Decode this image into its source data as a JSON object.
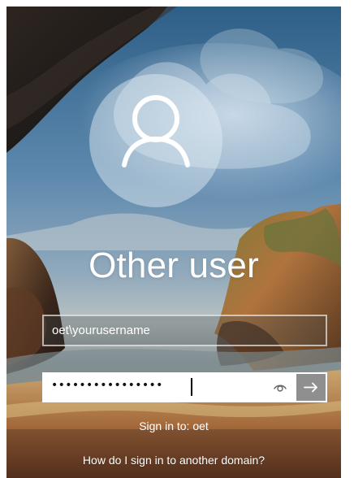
{
  "login": {
    "user_display_name": "Other user",
    "username_value": "oet\\yourusername",
    "password_masked": "••••••••••••••••",
    "sign_in_to_text": "Sign in to: oet",
    "help_link_text": "How do I sign in to another domain?"
  },
  "icons": {
    "avatar": "user-silhouette-icon",
    "password_reveal": "eye-icon",
    "submit": "arrow-right-icon"
  },
  "colors": {
    "text": "#ffffff",
    "password_field_background": "#ffffff",
    "submit_button": "#8f8f8f"
  }
}
